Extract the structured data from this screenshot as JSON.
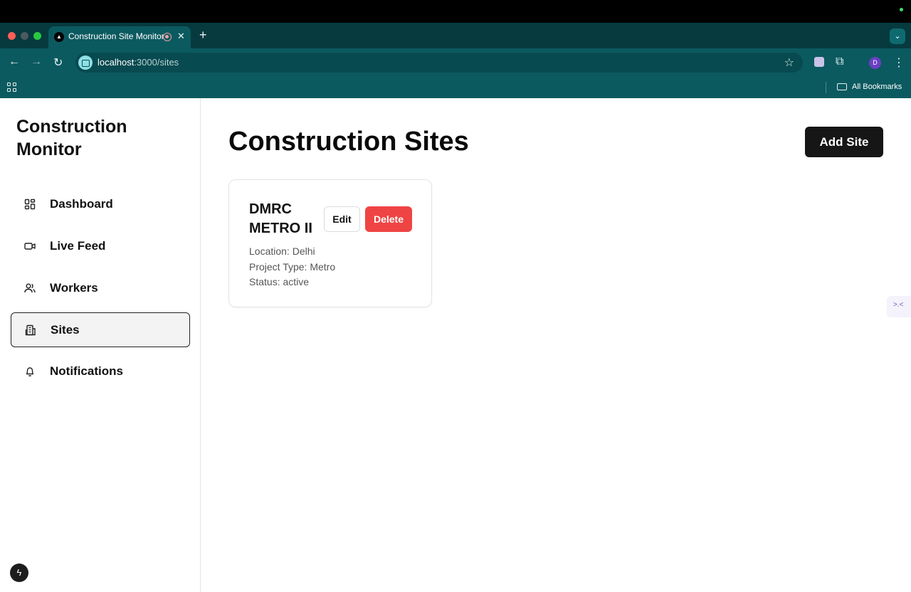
{
  "browser": {
    "tab_title": "Construction Site Monitor",
    "tab_favicon": "▲",
    "tab_close": "✕",
    "new_tab": "+",
    "url_host": "localhost",
    "url_path": ":3000/sites",
    "profile_initial": "D",
    "bookmarks_label": "All Bookmarks",
    "accent_color": "#0b5a60"
  },
  "sidebar": {
    "brand": "Construction Monitor",
    "items": [
      {
        "label": "Dashboard",
        "icon": "dashboard-icon"
      },
      {
        "label": "Live Feed",
        "icon": "video-icon"
      },
      {
        "label": "Workers",
        "icon": "users-icon"
      },
      {
        "label": "Sites",
        "icon": "building-icon",
        "active": true
      },
      {
        "label": "Notifications",
        "icon": "bell-icon"
      }
    ]
  },
  "main": {
    "title": "Construction Sites",
    "add_button": "Add Site",
    "sites": [
      {
        "name": "DMRC METRO II",
        "edit_label": "Edit",
        "delete_label": "Delete",
        "location": "Location: Delhi",
        "project_type": "Project Type: Metro",
        "status": "Status: active"
      }
    ]
  },
  "colors": {
    "delete": "#ef4444",
    "primary_button": "#161616"
  }
}
